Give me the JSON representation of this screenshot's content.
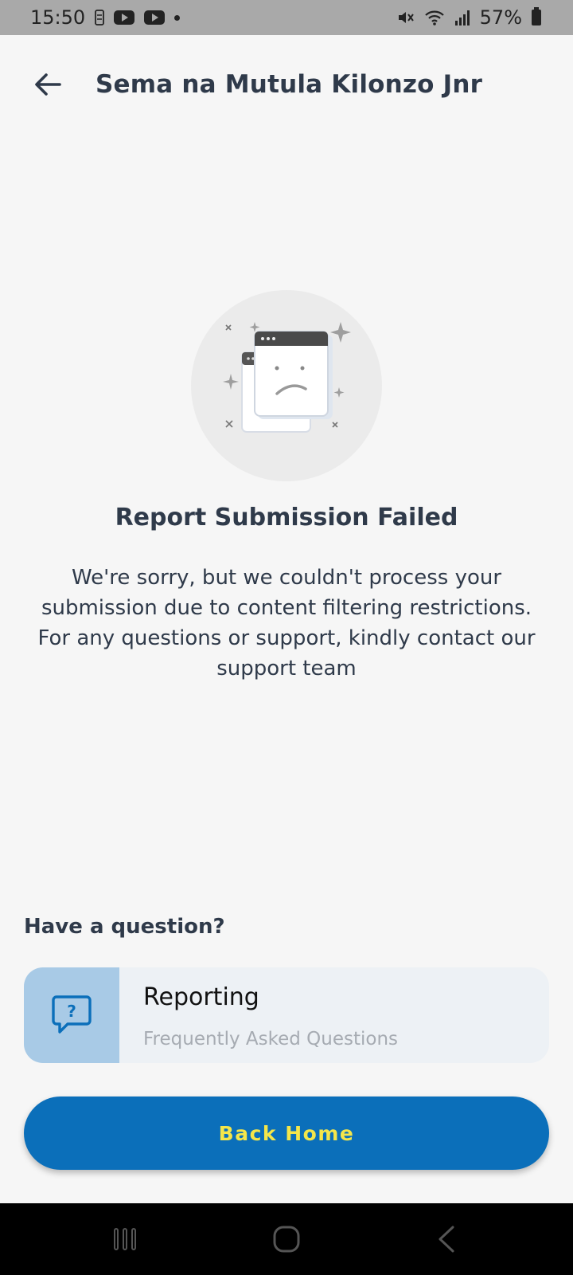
{
  "status_bar": {
    "time": "15:50",
    "battery_percent": "57%",
    "icons": [
      "notification-icon",
      "youtube-icon",
      "youtube-icon",
      "dot-icon",
      "mute-icon",
      "wifi-icon",
      "signal-icon",
      "battery-icon"
    ]
  },
  "header": {
    "title": "Sema na Mutula Kilonzo Jnr",
    "back_icon": "arrow-left-icon"
  },
  "result": {
    "title": "Report Submission Failed",
    "message": "We're sorry, but we couldn't process your submission due to content filtering restrictions. For any questions or support, kindly contact our support team"
  },
  "help": {
    "label": "Have a question?",
    "card": {
      "title": "Reporting",
      "subtitle": "Frequently Asked Questions",
      "icon": "question-bubble-icon"
    }
  },
  "actions": {
    "back_home_label": "Back Home"
  },
  "nav_bar": {
    "buttons": [
      "recents-icon",
      "home-icon",
      "back-icon"
    ]
  },
  "colors": {
    "primary_button": "#0b6fba",
    "button_text": "#f4e64a",
    "faq_icon_bg": "#a8cae6",
    "text": "#2f3a4a"
  }
}
